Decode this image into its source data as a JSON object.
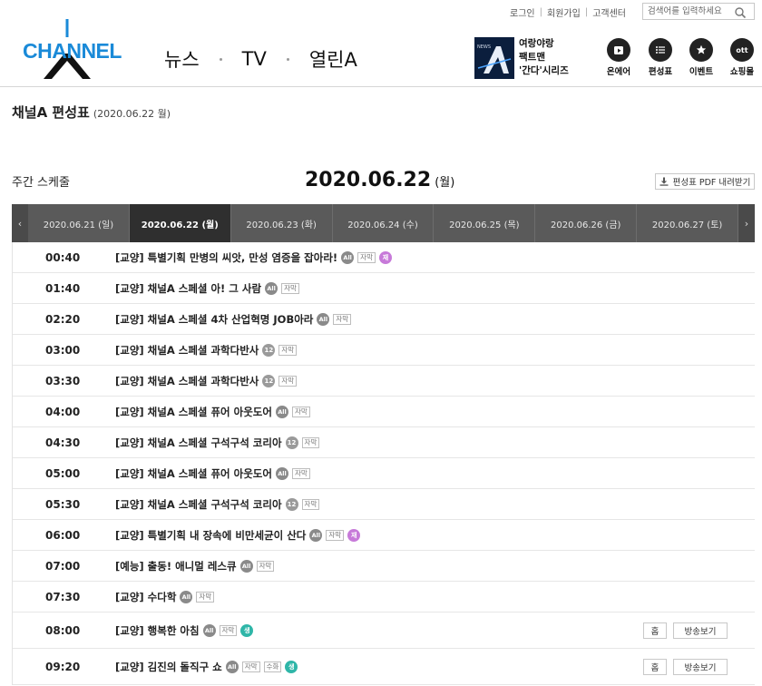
{
  "util": {
    "login": "로그인",
    "signup": "회원가입",
    "support": "고객센터"
  },
  "search": {
    "placeholder": "검색어를 입력하세요"
  },
  "logo": {
    "text": "CHANNEL"
  },
  "gnb": {
    "news": "뉴스",
    "tv": "TV",
    "open": "열린A"
  },
  "promo": {
    "line1": "여랑야랑",
    "line2": "팩트맨",
    "line3": "'간다'시리즈",
    "thumb_label": "NEWS"
  },
  "quick": [
    {
      "label": "온에어",
      "icon": "play-icon"
    },
    {
      "label": "편성표",
      "icon": "list-icon"
    },
    {
      "label": "이벤트",
      "icon": "star-icon"
    },
    {
      "label": "쇼핑몰",
      "icon": "ott-icon",
      "icon_text": "ott"
    }
  ],
  "page": {
    "title": "채널A 편성표",
    "date": "(2020.06.22 월)",
    "weekly": "주간 스케줄",
    "current_date": "2020.06.22",
    "current_weekday": "(월)",
    "pdf": "편성표 PDF 내려받기"
  },
  "tabs": [
    "2020.06.21 (일)",
    "2020.06.22 (월)",
    "2020.06.23 (화)",
    "2020.06.24 (수)",
    "2020.06.25 (목)",
    "2020.06.26 (금)",
    "2020.06.27 (토)"
  ],
  "tabs_active_index": 1,
  "tab_arrows": {
    "prev": "‹",
    "next": "›"
  },
  "badges": {
    "all": "All",
    "age12": "12",
    "sub": "자막",
    "sign": "수화",
    "re": "재",
    "live": "생"
  },
  "buttons": {
    "home": "홈",
    "watch": "방송보기"
  },
  "schedule": [
    {
      "time": "00:40",
      "title": "[교양] 특별기획 만병의 씨앗, 만성 염증을 잡아라!",
      "tags": [
        "all",
        "sub",
        "re"
      ]
    },
    {
      "time": "01:40",
      "title": "[교양] 채널A 스페셜 아! 그 사람",
      "tags": [
        "all",
        "sub"
      ]
    },
    {
      "time": "02:20",
      "title": "[교양] 채널A 스페셜 4차 산업혁명 JOB아라",
      "tags": [
        "all",
        "sub"
      ]
    },
    {
      "time": "03:00",
      "title": "[교양] 채널A 스페셜 과학다반사",
      "tags": [
        "age12",
        "sub"
      ]
    },
    {
      "time": "03:30",
      "title": "[교양] 채널A 스페셜 과학다반사",
      "tags": [
        "age12",
        "sub"
      ]
    },
    {
      "time": "04:00",
      "title": "[교양] 채널A 스페셜 퓨어 아웃도어",
      "tags": [
        "all",
        "sub"
      ]
    },
    {
      "time": "04:30",
      "title": "[교양] 채널A 스페셜 구석구석 코리아",
      "tags": [
        "age12",
        "sub"
      ]
    },
    {
      "time": "05:00",
      "title": "[교양] 채널A 스페셜 퓨어 아웃도어",
      "tags": [
        "all",
        "sub"
      ]
    },
    {
      "time": "05:30",
      "title": "[교양] 채널A 스페셜 구석구석 코리아",
      "tags": [
        "age12",
        "sub"
      ]
    },
    {
      "time": "06:00",
      "title": "[교양] 특별기획 내 장속에 비만세균이 산다",
      "tags": [
        "all",
        "sub",
        "re"
      ]
    },
    {
      "time": "07:00",
      "title": "[예능] 출동! 애니멀 레스큐",
      "tags": [
        "all",
        "sub"
      ]
    },
    {
      "time": "07:30",
      "title": "[교양] 수다학",
      "tags": [
        "all",
        "sub"
      ]
    },
    {
      "time": "08:00",
      "title": "[교양] 행복한 아침",
      "tags": [
        "all",
        "sub",
        "live"
      ],
      "buttons": true
    },
    {
      "time": "09:20",
      "title": "[교양] 김진의 돌직구 쇼",
      "tags": [
        "all",
        "sub",
        "sign",
        "live"
      ],
      "buttons": true
    }
  ]
}
